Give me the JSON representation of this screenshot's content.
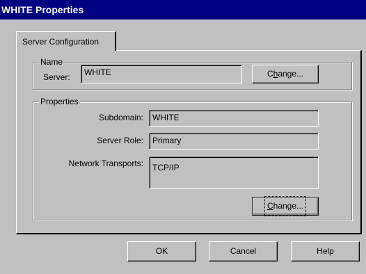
{
  "window": {
    "title": "WHITE Properties"
  },
  "tabs": [
    {
      "label": "Server Configuration"
    }
  ],
  "name_group": {
    "label": "Name",
    "server_label": "Server:",
    "server_value": "WHITE",
    "change_button": {
      "pre": "C",
      "accel": "h",
      "post": "ange..."
    }
  },
  "properties_group": {
    "label": "Properties",
    "subdomain_label": "Subdomain:",
    "subdomain_value": "WHITE",
    "role_label": "Server Role:",
    "role_value": "Primary",
    "transports_label": "Network Transports:",
    "transports_value": "TCP/IP",
    "change_button": {
      "pre": "",
      "accel": "C",
      "post": "hange..."
    }
  },
  "buttons": {
    "ok": "OK",
    "cancel": "Cancel",
    "help": "Help"
  }
}
